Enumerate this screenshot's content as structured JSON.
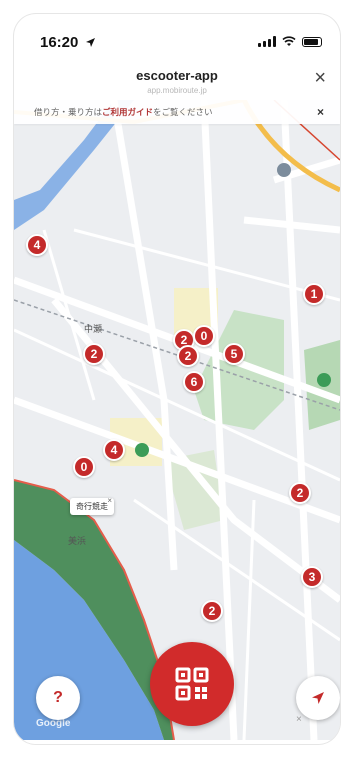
{
  "status_bar": {
    "time": "16:20"
  },
  "header": {
    "title": "escooter-app",
    "url": "app.mobiroute.jp",
    "close_label": "×"
  },
  "notice": {
    "prefix": "借り方・乗り方は",
    "link": "ご利用ガイド",
    "suffix": "をご覧ください",
    "close_label": "×"
  },
  "map": {
    "poi_labels": {
      "chuo": "中瀬",
      "mihama": "美浜"
    },
    "tooltip": "奇行競走",
    "tooltip_close": "×",
    "attribution": "Google",
    "ad_close": "×",
    "markers": [
      "4",
      "1",
      "2",
      "0",
      "2",
      "2",
      "5",
      "6",
      "4",
      "0",
      "2",
      "3",
      "2"
    ]
  },
  "buttons": {
    "help_label": "?"
  },
  "colors": {
    "accent": "#d12b2b",
    "marker": "#c42a2a"
  },
  "icons": [
    "location-arrow-icon",
    "wifi-icon",
    "signal-icon",
    "battery-icon",
    "qr-code-icon",
    "navigate-icon",
    "close-icon",
    "pin-icon"
  ]
}
